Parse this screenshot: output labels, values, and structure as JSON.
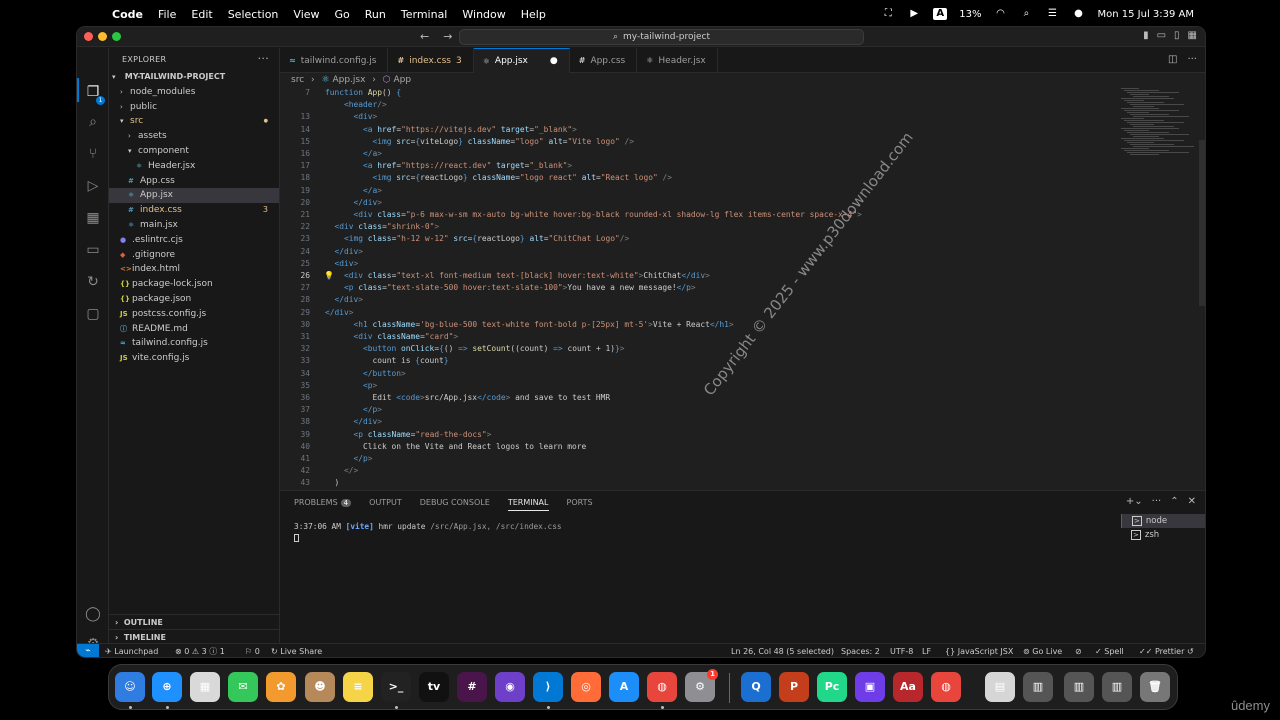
{
  "menubar": {
    "items": [
      "Code",
      "File",
      "Edit",
      "Selection",
      "View",
      "Go",
      "Run",
      "Terminal",
      "Window",
      "Help"
    ],
    "battery": "13%",
    "datetime": "Mon 15 Jul  3:39 AM",
    "badge_a": "A"
  },
  "titlebar": {
    "search": "my-tailwind-project"
  },
  "activity_badge": "1",
  "explorer": {
    "header": "EXPLORER",
    "project": "MY-TAILWIND-PROJECT",
    "items": [
      {
        "label": "node_modules",
        "kind": "folder",
        "indent": 1,
        "open": false
      },
      {
        "label": "public",
        "kind": "folder",
        "indent": 1,
        "open": false
      },
      {
        "label": "src",
        "kind": "folder",
        "indent": 1,
        "open": true,
        "color": "#e2c08d",
        "dot": true
      },
      {
        "label": "assets",
        "kind": "folder",
        "indent": 2,
        "open": false
      },
      {
        "label": "component",
        "kind": "folder",
        "indent": 2,
        "open": true
      },
      {
        "label": "Header.jsx",
        "kind": "jsx",
        "indent": 3
      },
      {
        "label": "App.css",
        "kind": "css",
        "indent": 2
      },
      {
        "label": "App.jsx",
        "kind": "jsx",
        "indent": 2,
        "selected": true
      },
      {
        "label": "index.css",
        "kind": "css",
        "indent": 2,
        "color": "#e2c08d",
        "mod": "3"
      },
      {
        "label": "main.jsx",
        "kind": "jsx",
        "indent": 2
      },
      {
        "label": ".eslintrc.cjs",
        "kind": "eslint",
        "indent": 1
      },
      {
        "label": ".gitignore",
        "kind": "git",
        "indent": 1
      },
      {
        "label": "index.html",
        "kind": "html",
        "indent": 1
      },
      {
        "label": "package-lock.json",
        "kind": "json",
        "indent": 1
      },
      {
        "label": "package.json",
        "kind": "json",
        "indent": 1
      },
      {
        "label": "postcss.config.js",
        "kind": "js",
        "indent": 1
      },
      {
        "label": "README.md",
        "kind": "md",
        "indent": 1
      },
      {
        "label": "tailwind.config.js",
        "kind": "tw",
        "indent": 1
      },
      {
        "label": "vite.config.js",
        "kind": "js",
        "indent": 1
      }
    ],
    "outline": "OUTLINE",
    "timeline": "TIMELINE"
  },
  "tabs": [
    {
      "label": "tailwind.config.js",
      "icon": "≈",
      "color": "#38bdf8"
    },
    {
      "label": "index.css",
      "icon": "#",
      "color": "#e2c08d",
      "num": "3"
    },
    {
      "label": "App.jsx",
      "icon": "⚛",
      "color": "#ccc",
      "active": true,
      "dirty": "●"
    },
    {
      "label": "App.css",
      "icon": "#",
      "color": "#ccc"
    },
    {
      "label": "Header.jsx",
      "icon": "⚛",
      "color": "#ccc"
    }
  ],
  "breadcrumb": [
    "src",
    "App.jsx",
    "App"
  ],
  "code_lines": [
    {
      "n": "7",
      "t": "function App() {"
    },
    {
      "n": "",
      "t": "    <header/>"
    },
    {
      "n": "13",
      "t": "      <div>"
    },
    {
      "n": "14",
      "t": "        <a href=\"https://vitejs.dev\" target=\"_blank\">"
    },
    {
      "n": "15",
      "t": "          <img src={viteLogo} className=\"logo\" alt=\"Vite logo\" />"
    },
    {
      "n": "16",
      "t": "        </a>"
    },
    {
      "n": "17",
      "t": "        <a href=\"https://react.dev\" target=\"_blank\">"
    },
    {
      "n": "18",
      "t": "          <img src={reactLogo} className=\"logo react\" alt=\"React logo\" />"
    },
    {
      "n": "19",
      "t": "        </a>"
    },
    {
      "n": "20",
      "t": "      </div>"
    },
    {
      "n": "21",
      "t": "      <div class=\"p-6 max-w-sm mx-auto bg-white hover:bg-black rounded-xl shadow-lg flex items-center space-x-4\">"
    },
    {
      "n": "22",
      "t": "  <div class=\"shrink-0\">"
    },
    {
      "n": "23",
      "t": "    <img class=\"h-12 w-12\" src={reactLogo} alt=\"ChitChat Logo\"/>"
    },
    {
      "n": "24",
      "t": "  </div>"
    },
    {
      "n": "25",
      "t": "  <div>"
    },
    {
      "n": "26",
      "t": "    <div class=\"text-xl font-medium text-[black] hover:text-white\">ChitChat</div>",
      "current": true
    },
    {
      "n": "27",
      "t": "    <p class=\"text-slate-500 hover:text-slate-100\">You have a new message!</p>"
    },
    {
      "n": "28",
      "t": "  </div>"
    },
    {
      "n": "29",
      "t": "</div>"
    },
    {
      "n": "30",
      "t": "      <h1 className='bg-blue-500 text-white font-bold p-[25px] mt-5'>Vite + React</h1>"
    },
    {
      "n": "31",
      "t": "      <div className=\"card\">"
    },
    {
      "n": "32",
      "t": "        <button onClick={() => setCount((count) => count + 1)}>"
    },
    {
      "n": "33",
      "t": "          count is {count}"
    },
    {
      "n": "34",
      "t": "        </button>"
    },
    {
      "n": "35",
      "t": "        <p>"
    },
    {
      "n": "36",
      "t": "          Edit <code>src/App.jsx</code> and save to test HMR"
    },
    {
      "n": "37",
      "t": "        </p>"
    },
    {
      "n": "38",
      "t": "      </div>"
    },
    {
      "n": "39",
      "t": "      <p className=\"read-the-docs\">"
    },
    {
      "n": "40",
      "t": "        Click on the Vite and React logos to learn more"
    },
    {
      "n": "41",
      "t": "      </p>"
    },
    {
      "n": "42",
      "t": "    </>"
    },
    {
      "n": "43",
      "t": "  )"
    },
    {
      "n": "44",
      "t": "}"
    }
  ],
  "watermark": "Copyright © 2025 - www.p30download.com",
  "panel": {
    "tabs": [
      {
        "label": "PROBLEMS",
        "badge": "4"
      },
      {
        "label": "OUTPUT"
      },
      {
        "label": "DEBUG CONSOLE"
      },
      {
        "label": "TERMINAL",
        "active": true
      },
      {
        "label": "PORTS"
      }
    ],
    "terminal": {
      "time": "3:37:06 AM",
      "tag": "[vite]",
      "msg": "hmr update",
      "paths": "/src/App.jsx, /src/index.css"
    },
    "terminals": [
      "node",
      "zsh"
    ]
  },
  "statusbar": {
    "launchpad": "Launchpad",
    "problems": "⊗ 0 ⚠ 3 ⓘ 1",
    "ports": "⚐ 0",
    "liveshare": "Live Share",
    "position": "Ln 26, Col 48 (5 selected)",
    "spaces": "Spaces: 2",
    "encoding": "UTF-8",
    "eol": "LF",
    "language": "JavaScript JSX",
    "golive": "Go Live",
    "spell": "Spell",
    "prettier": "Prettier"
  },
  "dock": {
    "notification": "1"
  },
  "brand": "ûdemy"
}
